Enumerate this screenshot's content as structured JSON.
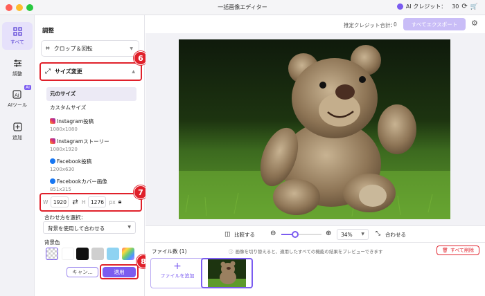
{
  "window": {
    "title": "一括画像エディター"
  },
  "header": {
    "ai_credit_label": "AI クレジット：",
    "ai_credit_value": "30"
  },
  "rail": {
    "items": [
      {
        "label": "すべて",
        "icon": "grid-icon"
      },
      {
        "label": "調整",
        "icon": "sliders-icon"
      },
      {
        "label": "AIツール",
        "icon": "ai-icon",
        "badge": "AI"
      },
      {
        "label": "追加",
        "icon": "plus-square-icon"
      }
    ]
  },
  "panel": {
    "title": "調整",
    "crop_label": "クロップ＆回転",
    "resize_label": "サイズ変更",
    "size_options": [
      {
        "label": "元のサイズ",
        "dims": ""
      },
      {
        "label": "カスタムサイズ",
        "dims": ""
      },
      {
        "label": "Instagram投稿",
        "dims": "1080x1080"
      },
      {
        "label": "Instagramストーリー",
        "dims": "1080x1920"
      },
      {
        "label": "Facebook投稿",
        "dims": "1200x630"
      },
      {
        "label": "Facebookカバー画像",
        "dims": "851x315"
      }
    ],
    "width_label": "W",
    "width_value": "1920",
    "swap_glyph": "⇄",
    "height_label": "H",
    "height_value": "1276",
    "unit": "px",
    "fit_label": "合わせ方を選択：",
    "fit_value": "背景を使用して合わせる",
    "bg_label": "背景色",
    "cancel_label": "キャン...",
    "apply_label": "適用"
  },
  "annotations": [
    "6",
    "7",
    "8"
  ],
  "toolbar": {
    "estimate_label": "推定クレジット合計：",
    "estimate_value": "0",
    "export_label": "すべてエクスポート"
  },
  "zoom": {
    "compare_label": "比較する",
    "value": "34%",
    "fit_label": "合わせる",
    "level": 0.34
  },
  "files": {
    "count_label": "ファイル数 (1)",
    "hint": "画像を切り替えると、適用したすべての機能の結果をプレビューできます",
    "delete_all_label": "すべて削除",
    "add_file_label": "ファイルを追加"
  },
  "colors": {
    "accent": "#7b5cf0",
    "highlight": "#e0202a",
    "export_button": "#c9bdf7"
  }
}
